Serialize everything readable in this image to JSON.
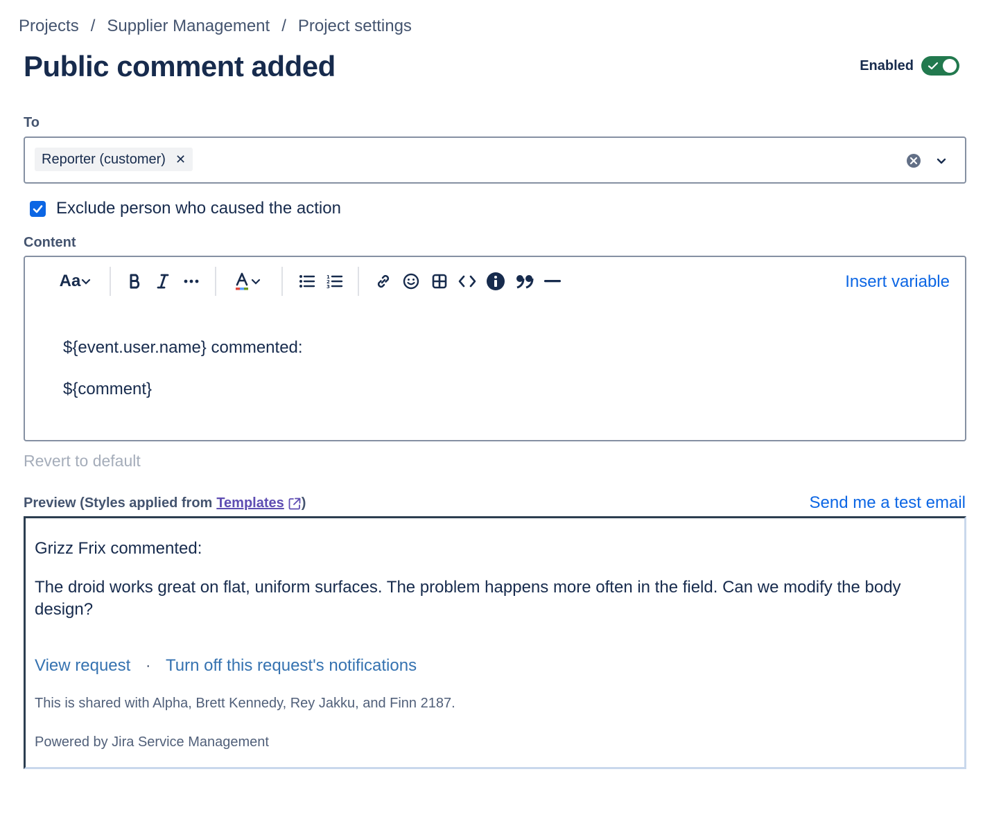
{
  "breadcrumb": {
    "items": [
      "Projects",
      "Supplier Management",
      "Project settings"
    ],
    "separator": "/"
  },
  "page": {
    "title": "Public comment added",
    "enabled_label": "Enabled",
    "enabled": true
  },
  "to": {
    "label": "To",
    "tags": [
      "Reporter (customer)"
    ]
  },
  "exclude": {
    "label": "Exclude person who caused the action",
    "checked": true
  },
  "content": {
    "label": "Content",
    "toolbar": {
      "text_style": "Aa",
      "insert_variable": "Insert variable"
    },
    "body": [
      "${event.user.name} commented:",
      "${comment}"
    ]
  },
  "revert_label": "Revert to default",
  "preview": {
    "label_prefix": "Preview (Styles applied from",
    "templates_link": "Templates",
    "label_suffix": ")",
    "send_test": "Send me a test email",
    "greeting": "Grizz Frix commented:",
    "body": "The droid works great on flat, uniform surfaces. The problem happens more often in the field. Can we modify the body design?",
    "view_request": "View request",
    "link_separator": "·",
    "turn_off": "Turn off this request's notifications",
    "shared": "This is shared with Alpha, Brett Kennedy, Rey Jakku, and Finn 2187.",
    "powered": "Powered by Jira Service Management"
  },
  "colors": {
    "primary_link": "#0c66e4",
    "toggle_on": "#22794e",
    "preview_link": "#3572b0",
    "templates_link": "#5e4db2"
  }
}
